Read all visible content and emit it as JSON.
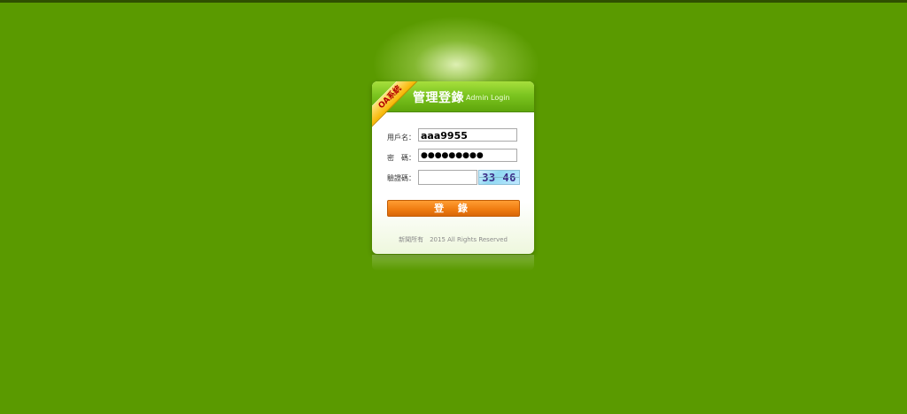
{
  "system": {
    "ribbon_text": "OA系統"
  },
  "header": {
    "title": "管理登錄",
    "subtitle": "Admin Login"
  },
  "form": {
    "username_label": "用戶名：",
    "username_value": "aaa9955",
    "password_label": "密　碼：",
    "password_masked": "●●●●●●●●●",
    "captcha_label": "驗證碼：",
    "captcha_value": "",
    "captcha_text": "33 46"
  },
  "login_button": {
    "label": "登 錄"
  },
  "footer": {
    "text": "新聞所有　2015  All  Rights  Reserved"
  },
  "colors": {
    "background": "#5a9a00",
    "header_green": "#7cc520",
    "button_orange": "#f07d12",
    "ribbon_yellow": "#f7b500"
  }
}
